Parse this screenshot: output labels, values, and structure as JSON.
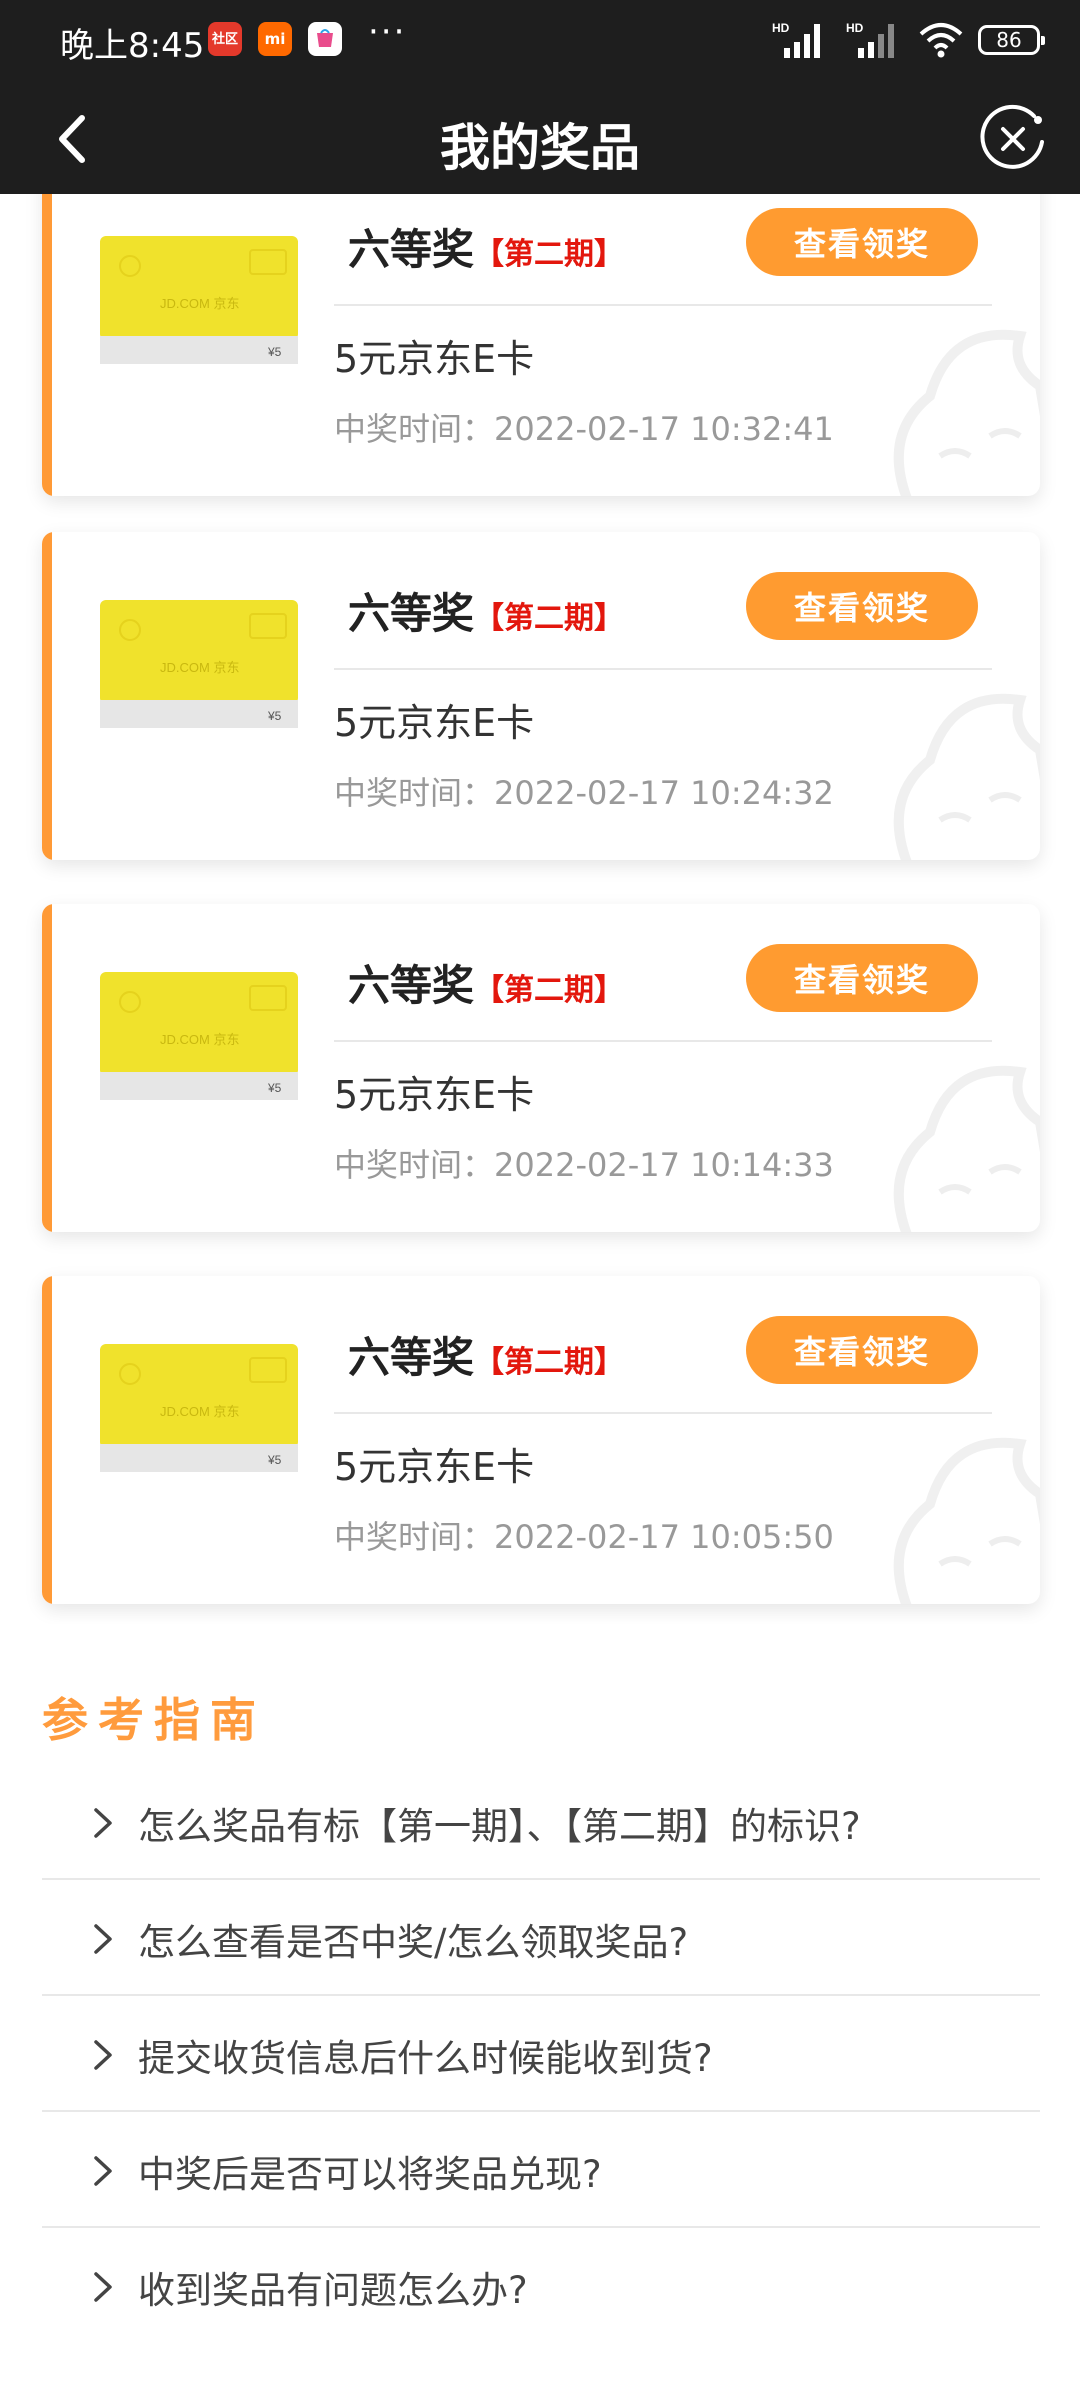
{
  "status_bar": {
    "time": "晚上8:45",
    "app_icons": [
      {
        "name": "community-app-icon",
        "label": "社区",
        "color": "#e4392b"
      },
      {
        "name": "mi-app-icon",
        "label": "mi",
        "color": "#ff6900"
      },
      {
        "name": "store-app-icon",
        "label": "",
        "color": "#ffffff"
      }
    ],
    "more": "···",
    "signal_label_1": "HD",
    "signal_label_2": "HD",
    "battery": "86"
  },
  "header": {
    "title": "我的奖品",
    "back_icon": "chevron-left-icon",
    "close_icon": "close-circle-icon"
  },
  "prizes": [
    {
      "level": "六等奖",
      "period": "【第二期】",
      "button": "查看领奖",
      "name": "5元京东E卡",
      "time_label": "中奖时间：",
      "time": "2022-02-17 10:32:41",
      "card_brand": "JD.COM 京东",
      "card_value": "¥5"
    },
    {
      "level": "六等奖",
      "period": "【第二期】",
      "button": "查看领奖",
      "name": "5元京东E卡",
      "time_label": "中奖时间：",
      "time": "2022-02-17 10:24:32",
      "card_brand": "JD.COM 京东",
      "card_value": "¥5"
    },
    {
      "level": "六等奖",
      "period": "【第二期】",
      "button": "查看领奖",
      "name": "5元京东E卡",
      "time_label": "中奖时间：",
      "time": "2022-02-17 10:14:33",
      "card_brand": "JD.COM 京东",
      "card_value": "¥5"
    },
    {
      "level": "六等奖",
      "period": "【第二期】",
      "button": "查看领奖",
      "name": "5元京东E卡",
      "time_label": "中奖时间：",
      "time": "2022-02-17 10:05:50",
      "card_brand": "JD.COM 京东",
      "card_value": "¥5"
    }
  ],
  "guide": {
    "title": "参考指南",
    "items": [
      "怎么奖品有标【第一期】、【第二期】的标识?",
      "怎么查看是否中奖/怎么领取奖品?",
      "提交收货信息后什么时候能收到货?",
      "中奖后是否可以将奖品兑现?",
      "收到奖品有问题怎么办?"
    ]
  },
  "colors": {
    "accent": "#ff9b30",
    "period_red": "#e3170d",
    "header_bg": "#1e1e1e",
    "card_yellow": "#f0e22c"
  }
}
